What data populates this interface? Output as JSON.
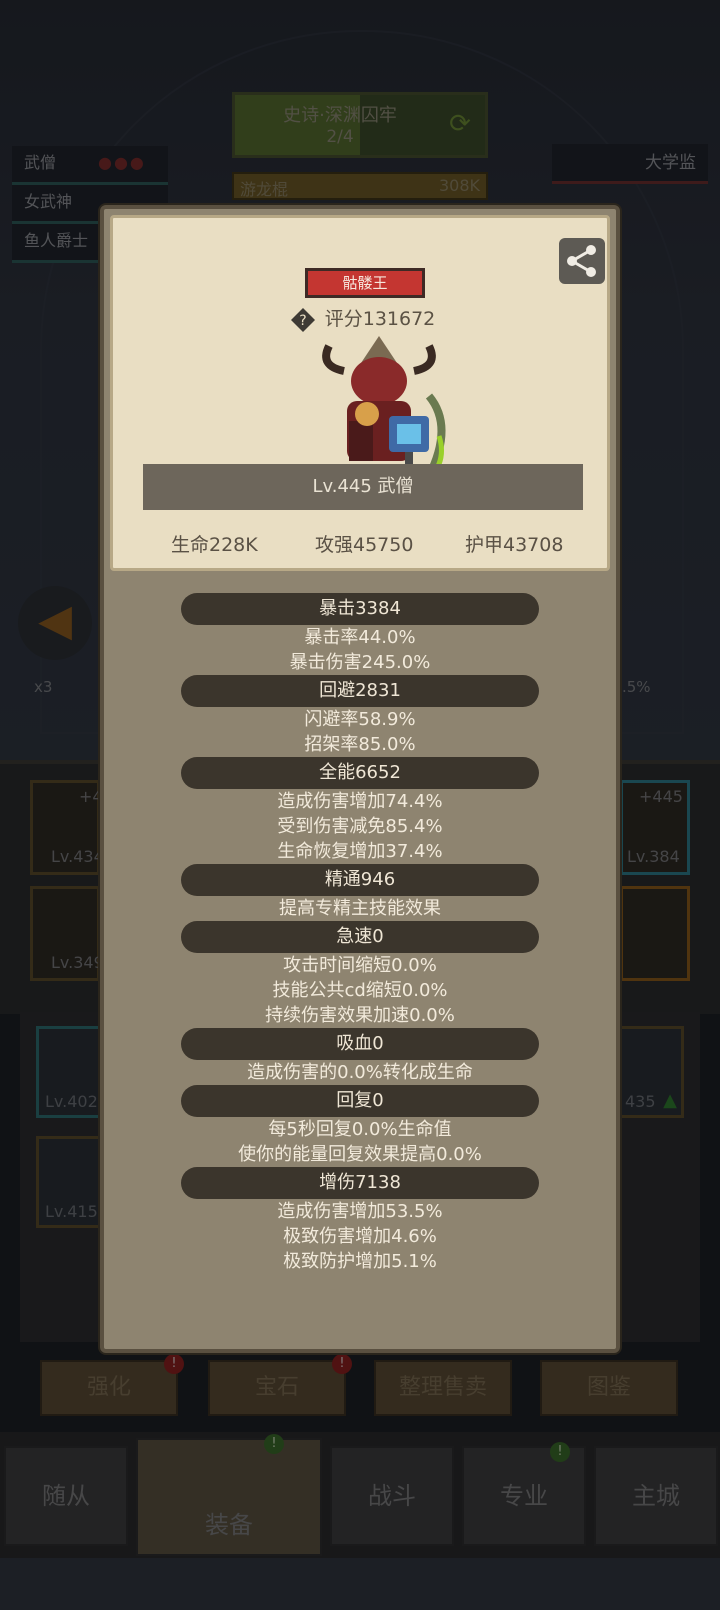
{
  "background": {
    "dungeon": {
      "title": "史诗·深渊囚牢",
      "progress": "2/4"
    },
    "boss_hp": {
      "name": "游龙棍",
      "value": "308K"
    },
    "party": [
      {
        "name": "武僧"
      },
      {
        "name": "女武神"
      },
      {
        "name": "鱼人爵士"
      }
    ],
    "enemy": {
      "name": "大学监"
    },
    "multiplier": "x3",
    "percent_right": ".5%",
    "equip_slots": [
      {
        "level": "Lv.434",
        "plus": "+4"
      },
      {
        "level": "Lv.349",
        "plus": ""
      },
      {
        "level": "Lv.384",
        "plus": "+445"
      }
    ],
    "inventory": [
      {
        "level": "Lv.402"
      },
      {
        "level": "Lv.415"
      },
      {
        "level": "435"
      }
    ],
    "actions": [
      {
        "label": "强化",
        "badge": "!"
      },
      {
        "label": "宝石",
        "badge": "!"
      },
      {
        "label": "整理售卖",
        "badge": ""
      },
      {
        "label": "图鉴",
        "badge": ""
      }
    ],
    "nav": [
      {
        "label": "随从",
        "badge": ""
      },
      {
        "label": "装备",
        "badge": "!"
      },
      {
        "label": "战斗",
        "badge": ""
      },
      {
        "label": "专业",
        "badge": "!"
      },
      {
        "label": "主城",
        "badge": ""
      }
    ]
  },
  "popup": {
    "name": "骷髅王",
    "score": "评分131672",
    "level": "Lv.445 武僧",
    "hero_stats": {
      "hp": "生命228K",
      "attack": "攻强45750",
      "armor": "护甲43708"
    },
    "sections": [
      {
        "header": "暴击3384",
        "lines": [
          "暴击率44.0%",
          "暴击伤害245.0%"
        ]
      },
      {
        "header": "回避2831",
        "lines": [
          "闪避率58.9%",
          "招架率85.0%"
        ]
      },
      {
        "header": "全能6652",
        "lines": [
          "造成伤害增加74.4%",
          "受到伤害减免85.4%",
          "生命恢复增加37.4%"
        ]
      },
      {
        "header": "精通946",
        "lines": [
          "提高专精主技能效果"
        ]
      },
      {
        "header": "急速0",
        "lines": [
          "攻击时间缩短0.0%",
          "技能公共cd缩短0.0%",
          "持续伤害效果加速0.0%"
        ]
      },
      {
        "header": "吸血0",
        "lines": [
          "造成伤害的0.0%转化成生命"
        ]
      },
      {
        "header": "回复0",
        "lines": [
          "每5秒回复0.0%生命值",
          "使你的能量回复效果提高0.0%"
        ]
      },
      {
        "header": "增伤7138",
        "lines": [
          "造成伤害增加53.5%",
          "极致伤害增加4.6%",
          "极致防护增加5.1%"
        ]
      }
    ]
  }
}
